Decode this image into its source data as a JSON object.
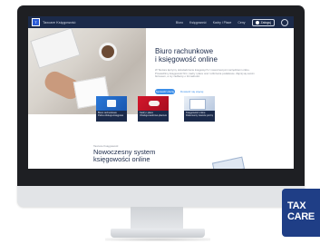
{
  "nav": {
    "logo_glyph": "T",
    "brand": "Taxcare Księgowość",
    "links": [
      "Biuro",
      "Księgowość",
      "Kadry i Płace",
      "Ceny"
    ],
    "login_label": "Zaloguj",
    "language_icon": "globe-icon"
  },
  "hero": {
    "title": "Biuro rachunkowe\ni księgowość online",
    "text": "W Taxcare łączymy doświadczenie księgowych z nowoczesnymi narzędziami online. Prowadzimy księgowość firm, kadry i płace oraz rozliczenia podatkowe. Zajmij się swoim biznesem, a my zadbamy o formalności.",
    "primary_button": "Sprawdź ofertę",
    "secondary_link": "Dowiedz się więcej"
  },
  "cards": [
    {
      "label": "Biuro rachunkowe",
      "caption": "Pełna obsługa księgowa"
    },
    {
      "label": "Kadry i płace",
      "caption": "Obsługa kadrowo-płacowa"
    },
    {
      "label": "Księgowość online",
      "caption": "Dokumenty zawsze pod ręką"
    }
  ],
  "section": {
    "label": "Taxcare Księgowość",
    "title": "Nowoczesny system\nksięgowości online"
  },
  "badge": {
    "text": "TAX\nCARE"
  },
  "colors": {
    "navy": "#1b2a4a",
    "accent": "#3b8ee8",
    "badge": "#1f3e86",
    "card_red": "#d3162b",
    "card_blue": "#2a78d8"
  }
}
